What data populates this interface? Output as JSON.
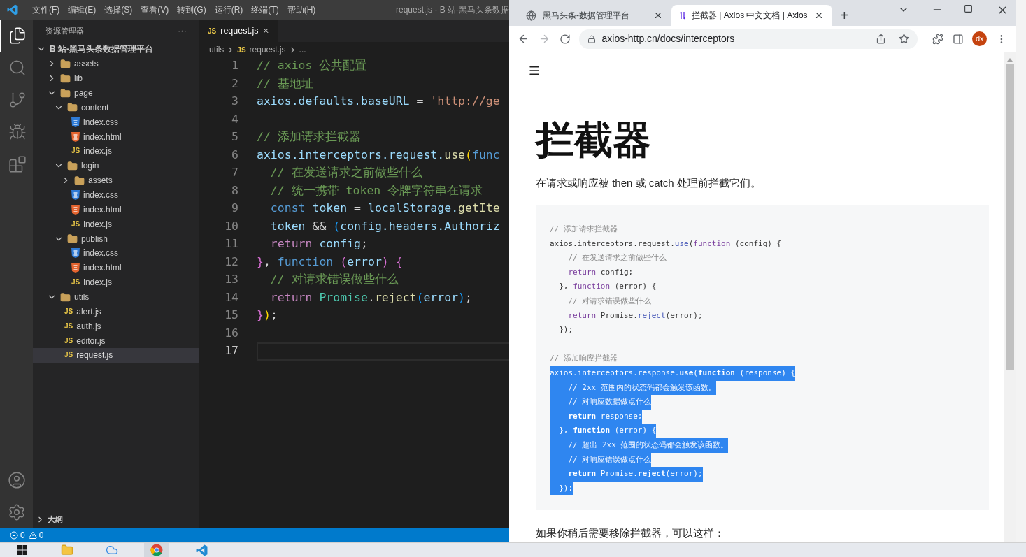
{
  "vscode": {
    "menu": [
      "文件(F)",
      "编辑(E)",
      "选择(S)",
      "查看(V)",
      "转到(G)",
      "运行(R)",
      "终端(T)",
      "帮助(H)"
    ],
    "title": "request.js - B 站-黑马头条数据",
    "activity": [
      {
        "kind": "files",
        "selected": true
      },
      {
        "kind": "search",
        "selected": false
      },
      {
        "kind": "git",
        "selected": false
      },
      {
        "kind": "debug",
        "selected": false
      },
      {
        "kind": "extensions",
        "selected": false
      }
    ],
    "activity_bottom": [
      {
        "kind": "account"
      },
      {
        "kind": "settings"
      }
    ],
    "explorer": {
      "title": "资源管理器",
      "more": "···",
      "tree": [
        {
          "label": "B 站-黑马头条数据管理平台",
          "kind": "root",
          "expanded": true,
          "selected": false,
          "children": [
            {
              "label": "assets",
              "kind": "folder",
              "expanded": false,
              "selected": false
            },
            {
              "label": "lib",
              "kind": "folder",
              "expanded": false,
              "selected": false
            },
            {
              "label": "page",
              "kind": "folder",
              "expanded": true,
              "selected": false,
              "children": [
                {
                  "label": "content",
                  "kind": "folder",
                  "expanded": true,
                  "selected": false,
                  "children": [
                    {
                      "label": "index.css",
                      "kind": "css",
                      "selected": false
                    },
                    {
                      "label": "index.html",
                      "kind": "html",
                      "selected": false
                    },
                    {
                      "label": "index.js",
                      "kind": "js",
                      "icon": "JS",
                      "selected": false
                    }
                  ]
                },
                {
                  "label": "login",
                  "kind": "folder",
                  "expanded": true,
                  "selected": false,
                  "children": [
                    {
                      "label": "assets",
                      "kind": "folder",
                      "expanded": false,
                      "selected": false
                    },
                    {
                      "label": "index.css",
                      "kind": "css",
                      "selected": false
                    },
                    {
                      "label": "index.html",
                      "kind": "html",
                      "selected": false
                    },
                    {
                      "label": "index.js",
                      "kind": "js",
                      "icon": "JS",
                      "selected": false
                    }
                  ]
                },
                {
                  "label": "publish",
                  "kind": "folder",
                  "expanded": true,
                  "selected": false,
                  "children": [
                    {
                      "label": "index.css",
                      "kind": "css",
                      "selected": false
                    },
                    {
                      "label": "index.html",
                      "kind": "html",
                      "selected": false
                    },
                    {
                      "label": "index.js",
                      "kind": "js",
                      "icon": "JS",
                      "selected": false
                    }
                  ]
                }
              ]
            },
            {
              "label": "utils",
              "kind": "folder",
              "expanded": true,
              "selected": false,
              "children": [
                {
                  "label": "alert.js",
                  "kind": "js",
                  "icon": "JS",
                  "selected": false
                },
                {
                  "label": "auth.js",
                  "kind": "js",
                  "icon": "JS",
                  "selected": false
                },
                {
                  "label": "editor.js",
                  "kind": "js",
                  "icon": "JS",
                  "selected": false
                },
                {
                  "label": "request.js",
                  "kind": "js",
                  "icon": "JS",
                  "selected": true
                }
              ]
            }
          ]
        }
      ]
    },
    "outline": {
      "label": "大纲",
      "expanded": false
    },
    "tab": {
      "icon": "JS",
      "label": "request.js"
    },
    "breadcrumb": [
      {
        "label": "utils"
      },
      {
        "icon": "JS",
        "label": "request.js"
      },
      {
        "label": "..."
      }
    ],
    "lines": [
      {
        "number": "1",
        "active": false,
        "tokens": [
          {
            "kind": "comment",
            "t": "// axios 公共配置"
          }
        ]
      },
      {
        "number": "2",
        "active": false,
        "tokens": [
          {
            "kind": "comment",
            "t": "// 基地址"
          }
        ]
      },
      {
        "number": "3",
        "active": false,
        "tokens": [
          {
            "kind": "var",
            "t": "axios.defaults.baseURL"
          },
          {
            "kind": "punct",
            "t": " = "
          },
          {
            "kind": "link",
            "t": "'http://ge"
          }
        ]
      },
      {
        "number": "4",
        "active": false
      },
      {
        "number": "5",
        "active": false,
        "tokens": [
          {
            "kind": "comment",
            "t": "// 添加请求拦截器"
          }
        ]
      },
      {
        "number": "6",
        "active": false,
        "tokens": [
          {
            "kind": "var",
            "t": "axios.interceptors.request."
          },
          {
            "kind": "fn",
            "t": "use"
          },
          {
            "kind": "bracket1",
            "t": "("
          },
          {
            "kind": "keyword",
            "t": "func"
          }
        ]
      },
      {
        "number": "7",
        "active": false,
        "tokens": [
          {
            "kind": "comment",
            "t": "  // 在发送请求之前做些什么"
          }
        ]
      },
      {
        "number": "8",
        "active": false,
        "tokens": [
          {
            "kind": "comment",
            "t": "  // 统一携带 token 令牌字符串在请求"
          }
        ]
      },
      {
        "number": "9",
        "active": false,
        "tokens": [
          {
            "kind": "keyword",
            "t": "  const "
          },
          {
            "kind": "var",
            "t": "token"
          },
          {
            "kind": "punct",
            "t": " = "
          },
          {
            "kind": "var",
            "t": "localStorage."
          },
          {
            "kind": "fn",
            "t": "getIte"
          }
        ]
      },
      {
        "number": "10",
        "active": false,
        "tokens": [
          {
            "kind": "var",
            "t": "  token"
          },
          {
            "kind": "punct",
            "t": " && "
          },
          {
            "kind": "bracket3",
            "t": "("
          },
          {
            "kind": "var",
            "t": "config.headers.Authoriz"
          }
        ]
      },
      {
        "number": "11",
        "active": false,
        "tokens": [
          {
            "kind": "control",
            "t": "  return "
          },
          {
            "kind": "var",
            "t": "config"
          },
          {
            "kind": "punct",
            "t": ";"
          }
        ]
      },
      {
        "number": "12",
        "active": false,
        "tokens": [
          {
            "kind": "bracket2",
            "t": "}"
          },
          {
            "kind": "punct",
            "t": ", "
          },
          {
            "kind": "keyword",
            "t": "function "
          },
          {
            "kind": "bracket2",
            "t": "("
          },
          {
            "kind": "var",
            "t": "error"
          },
          {
            "kind": "bracket2",
            "t": ") {"
          }
        ]
      },
      {
        "number": "13",
        "active": false,
        "tokens": [
          {
            "kind": "comment",
            "t": "  // 对请求错误做些什么"
          }
        ]
      },
      {
        "number": "14",
        "active": false,
        "tokens": [
          {
            "kind": "control",
            "t": "  return "
          },
          {
            "kind": "class",
            "t": "Promise"
          },
          {
            "kind": "punct",
            "t": "."
          },
          {
            "kind": "fn",
            "t": "reject"
          },
          {
            "kind": "bracket3",
            "t": "("
          },
          {
            "kind": "var",
            "t": "error"
          },
          {
            "kind": "bracket3",
            "t": ")"
          },
          {
            "kind": "punct",
            "t": ";"
          }
        ]
      },
      {
        "number": "15",
        "active": false,
        "tokens": [
          {
            "kind": "bracket2",
            "t": "}"
          },
          {
            "kind": "bracket1",
            "t": ")"
          },
          {
            "kind": "punct",
            "t": ";"
          }
        ]
      },
      {
        "number": "16",
        "active": false
      },
      {
        "number": "17",
        "active": true
      }
    ],
    "status": {
      "errors": "0",
      "warnings": "0"
    }
  },
  "browser": {
    "tabs": [
      {
        "title": "黑马头条-数据管理平台",
        "kind": "globe",
        "selected": false
      },
      {
        "title": "拦截器 | Axios 中文文档 | Axios",
        "kind": "site",
        "selected": true
      }
    ],
    "new_tab": "+",
    "address": "axios-http.cn/docs/interceptors",
    "profile": "dx",
    "page": {
      "heading": "拦截器",
      "intro": "在请求或响应被 then 或 catch 处理前拦截它们。",
      "code": [
        {
          "lines": [
            {
              "selected": false,
              "tokens": [
                {
                  "kind": "comment",
                  "t": "// 添加请求拦截器"
                }
              ]
            },
            {
              "selected": false,
              "tokens": [
                {
                  "kind": "plain",
                  "t": "axios.interceptors.request."
                },
                {
                  "kind": "fn",
                  "t": "use"
                },
                {
                  "kind": "plain",
                  "t": "("
                },
                {
                  "kind": "keyword",
                  "t": "function"
                },
                {
                  "kind": "plain",
                  "t": " (config) {"
                }
              ]
            },
            {
              "selected": false,
              "tokens": [
                {
                  "kind": "comment",
                  "t": "    // 在发送请求之前做些什么"
                }
              ]
            },
            {
              "selected": false,
              "tokens": [
                {
                  "kind": "keyword",
                  "t": "    return"
                },
                {
                  "kind": "plain",
                  "t": " config;"
                }
              ]
            },
            {
              "selected": false,
              "tokens": [
                {
                  "kind": "plain",
                  "t": "  }, "
                },
                {
                  "kind": "keyword",
                  "t": "function"
                },
                {
                  "kind": "plain",
                  "t": " (error) {"
                }
              ]
            },
            {
              "selected": false,
              "tokens": [
                {
                  "kind": "comment",
                  "t": "    // 对请求错误做些什么"
                }
              ]
            },
            {
              "selected": false,
              "tokens": [
                {
                  "kind": "keyword",
                  "t": "    return"
                },
                {
                  "kind": "plain",
                  "t": " Promise."
                },
                {
                  "kind": "fn",
                  "t": "reject"
                },
                {
                  "kind": "plain",
                  "t": "(error);"
                }
              ]
            },
            {
              "selected": false,
              "tokens": [
                {
                  "kind": "plain",
                  "t": "  });"
                }
              ]
            }
          ]
        },
        {
          "lines": [
            {
              "selected": false,
              "tokens": [
                {
                  "kind": "comment",
                  "t": "// 添加响应拦截器"
                }
              ]
            },
            {
              "selected": true,
              "tokens": [
                {
                  "kind": "plain",
                  "t": "axios.interceptors.response."
                },
                {
                  "kind": "fn",
                  "t": "use"
                },
                {
                  "kind": "plain",
                  "t": "("
                },
                {
                  "kind": "keyword",
                  "t": "function"
                },
                {
                  "kind": "plain",
                  "t": " (response) {"
                }
              ]
            },
            {
              "selected": true,
              "tokens": [
                {
                  "kind": "comment",
                  "t": "    // 2xx 范围内的状态码都会触发该函数。"
                }
              ]
            },
            {
              "selected": true,
              "tokens": [
                {
                  "kind": "comment",
                  "t": "    // 对响应数据做点什么"
                }
              ]
            },
            {
              "selected": true,
              "tokens": [
                {
                  "kind": "keyword",
                  "t": "    return"
                },
                {
                  "kind": "plain",
                  "t": " response;"
                }
              ]
            },
            {
              "selected": true,
              "tokens": [
                {
                  "kind": "plain",
                  "t": "  }, "
                },
                {
                  "kind": "keyword",
                  "t": "function"
                },
                {
                  "kind": "plain",
                  "t": " (error) {"
                }
              ]
            },
            {
              "selected": true,
              "tokens": [
                {
                  "kind": "comment",
                  "t": "    // 超出 2xx 范围的状态码都会触发该函数。"
                }
              ]
            },
            {
              "selected": true,
              "tokens": [
                {
                  "kind": "comment",
                  "t": "    // 对响应错误做点什么"
                }
              ]
            },
            {
              "selected": true,
              "tokens": [
                {
                  "kind": "keyword",
                  "t": "    return"
                },
                {
                  "kind": "plain",
                  "t": " Promise."
                },
                {
                  "kind": "fn",
                  "t": "reject"
                },
                {
                  "kind": "plain",
                  "t": "(error);"
                }
              ]
            },
            {
              "selected": true,
              "tokens": [
                {
                  "kind": "plain",
                  "t": "  });"
                }
              ]
            }
          ]
        }
      ],
      "after": "如果你稍后需要移除拦截器，可以这样："
    }
  },
  "taskbar": [
    {
      "kind": "start",
      "selected": false
    },
    {
      "kind": "folder",
      "selected": false
    },
    {
      "kind": "cloud",
      "selected": false
    },
    {
      "kind": "browser",
      "selected": true
    },
    {
      "kind": "editor",
      "selected": false
    }
  ]
}
